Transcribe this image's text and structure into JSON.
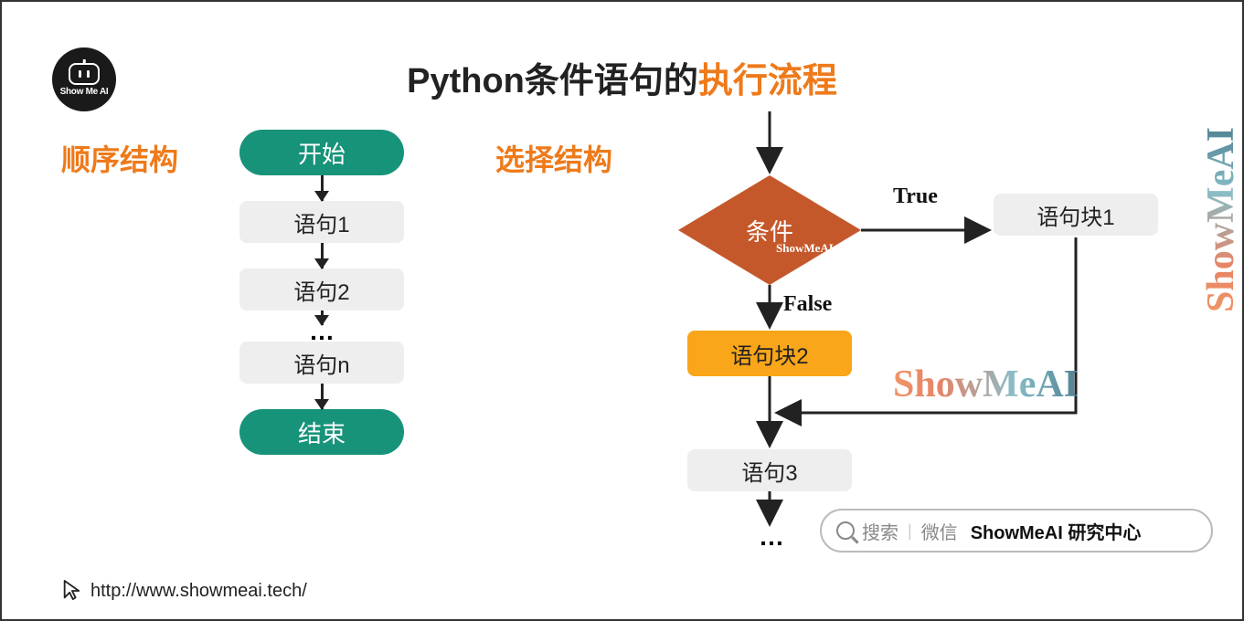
{
  "logo": {
    "text": "Show Me AI"
  },
  "title": {
    "prefix": "Python条件语句的",
    "highlight": "执行流程"
  },
  "sections": {
    "sequential": "顺序结构",
    "selection": "选择结构"
  },
  "sequential": {
    "start": "开始",
    "steps": [
      "语句1",
      "语句2",
      "语句n"
    ],
    "ellipsis": "…",
    "end": "结束"
  },
  "selection": {
    "condition": "条件",
    "watermark_in_diamond": "ShowMeAI",
    "true_label": "True",
    "false_label": "False",
    "block1": "语句块1",
    "block2": "语句块2",
    "stmt3": "语句3",
    "ellipsis": "…"
  },
  "watermark": "ShowMeAI",
  "search": {
    "label": "搜索",
    "channel": "微信",
    "brand": "ShowMeAI 研究中心"
  },
  "footer": {
    "url": "http://www.showmeai.tech/"
  }
}
